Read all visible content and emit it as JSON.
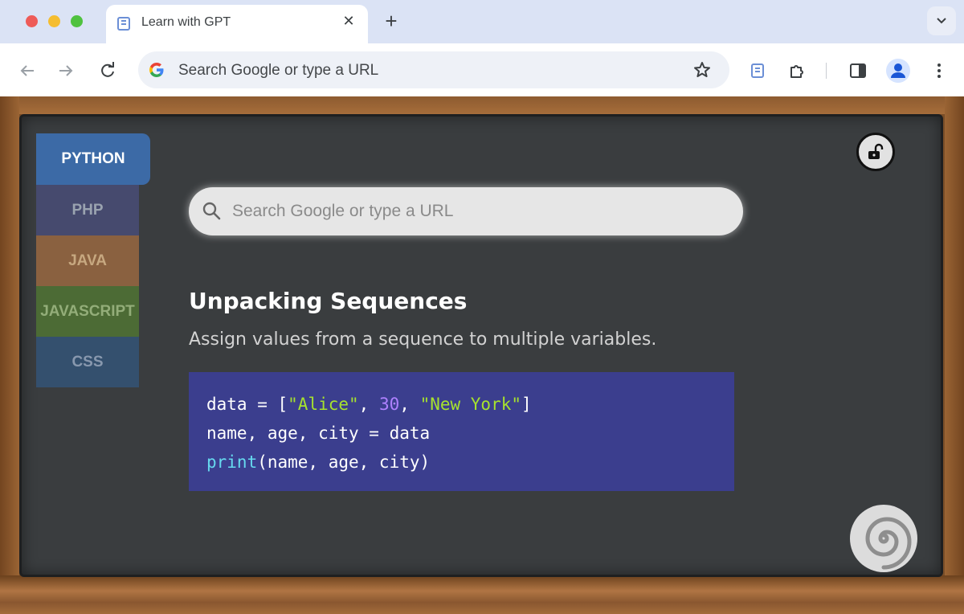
{
  "browser": {
    "tab_title": "Learn with GPT",
    "tab_close": "✕",
    "new_tab": "+",
    "omnibox_text": "Search Google or type a URL"
  },
  "sidebar": {
    "items": [
      {
        "label": "PYTHON",
        "active": true
      },
      {
        "label": "PHP",
        "active": false
      },
      {
        "label": "JAVA",
        "active": false
      },
      {
        "label": "JAVASCRIPT",
        "active": false
      },
      {
        "label": "CSS",
        "active": false
      }
    ]
  },
  "search": {
    "placeholder": "Search Google or type a URL"
  },
  "lesson": {
    "title": "Unpacking Sequences",
    "description": "Assign values from a sequence to multiple variables.",
    "code": {
      "line1": {
        "a": "data = [",
        "s1": "\"Alice\"",
        "b": ", ",
        "n1": "30",
        "c": ", ",
        "s2": "\"New York\"",
        "d": "]"
      },
      "line2": "name, age, city = data",
      "line3": {
        "fn": "print",
        "rest": "(name, age, city)"
      }
    }
  },
  "colors": {
    "board": "#3a3d3f",
    "frame": "#7a4e28",
    "python_tab": "#3c6aa6",
    "php_tab": "#464a6e",
    "java_tab": "#8a6140",
    "javascript_tab": "#4c6b35",
    "css_tab": "#34506e",
    "code_bg": "#3b3e8e"
  },
  "icons": {
    "favicon": "gpt-book-icon",
    "back": "arrow-left-icon",
    "forward": "arrow-right-icon",
    "reload": "reload-icon",
    "google": "google-g-icon",
    "bookmark": "star-icon",
    "extension": "puzzle-icon",
    "sidepanel": "side-panel-icon",
    "profile": "person-icon",
    "menu": "kebab-menu-icon",
    "lock": "unlock-icon",
    "search": "search-icon",
    "spiral": "spiral-icon"
  }
}
